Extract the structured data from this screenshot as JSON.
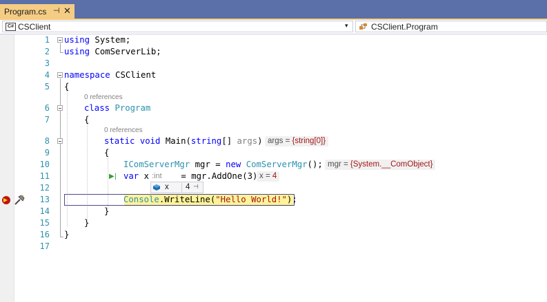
{
  "tab": {
    "title": "Program.cs",
    "pin_glyph": "⊣",
    "close_glyph": "✕"
  },
  "navbar": {
    "project_icon_text": "C#",
    "project": "CSClient",
    "dropdown_glyph": "▾",
    "member": "CSClient.Program"
  },
  "codelens": {
    "class_refs": "0 references",
    "main_refs": "0 references"
  },
  "lines": [
    {
      "n": "1"
    },
    {
      "n": "2"
    },
    {
      "n": "3"
    },
    {
      "n": "4"
    },
    {
      "n": "5"
    },
    {
      "n": "6"
    },
    {
      "n": "7"
    },
    {
      "n": "8"
    },
    {
      "n": "9"
    },
    {
      "n": "10"
    },
    {
      "n": "11"
    },
    {
      "n": "12"
    },
    {
      "n": "13"
    },
    {
      "n": "14"
    },
    {
      "n": "15"
    },
    {
      "n": "16"
    },
    {
      "n": "17"
    }
  ],
  "code": {
    "l1_kw": "using",
    "l1_rest": " System;",
    "l2_kw": "using",
    "l2_rest": " ComServerLib;",
    "l4_kw": "namespace",
    "l4_rest": " CSClient",
    "l5": "{",
    "l6_kw": "class",
    "l6_sp": " ",
    "l6_type": "Program",
    "l7": "{",
    "l8_kw1": "static",
    "l8_kw2": "void",
    "l8_name": "Main",
    "l8_p1": "(",
    "l8_kw3": "string",
    "l8_p2": "[] ",
    "l8_param": "args",
    "l8_p3": ")",
    "l9": "{",
    "l10_type1": "IComServerMgr",
    "l10_mid": " mgr = ",
    "l10_kw": "new",
    "l10_sp": " ",
    "l10_type2": "ComServerMgr",
    "l10_end": "();",
    "l11_kw": "var",
    "l11_name": " x",
    "l11_eq": " = mgr.AddOne(3);",
    "l13_type": "Console",
    "l13_mid": ".WriteLine(",
    "l13_str": "\"Hello World!\"",
    "l13_end": ");",
    "l14": "}",
    "l15": "}",
    "l16": "}"
  },
  "inline_values": {
    "args_name": "args",
    "args_eq": " = ",
    "args_val": "{string[0]}",
    "mgr_name": "mgr",
    "mgr_eq": " = ",
    "mgr_val": "{System.__ComObject}",
    "x_name": "x",
    "x_eq": " = ",
    "x_val": "4"
  },
  "type_hint": ":int",
  "datatip": {
    "name": "x",
    "value": "4",
    "pin_glyph": "⊣"
  },
  "gutter": {
    "current_line_arrow": "exec-arrow",
    "actions": "hammer-icon",
    "run_to_click": "▶|"
  },
  "colors": {
    "tab_active": "#f5cc84",
    "tabstrip": "#5b6fa8",
    "line_number": "#2b91af",
    "keyword": "#0000ff",
    "type": "#2b91af",
    "string": "#a31515",
    "current_statement": "#fff39a"
  }
}
